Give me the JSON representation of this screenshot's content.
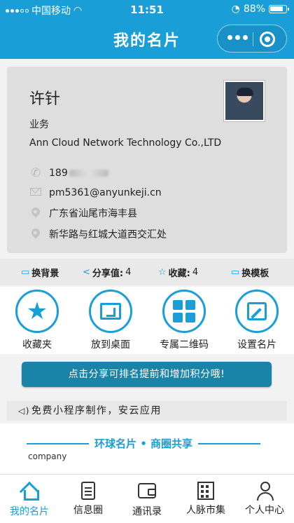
{
  "status_bar": {
    "carrier": "中国移动",
    "time": "11:51",
    "battery": "88%"
  },
  "nav": {
    "title": "我的名片"
  },
  "card": {
    "name": "许针",
    "role": "业务",
    "company": "Ann Cloud Network Technology Co.,LTD",
    "phone_visible": "189",
    "email": "pm5361@anyunkeji.cn",
    "address_line1": "广东省汕尾市海丰县",
    "address_line2": "新华路与红城大道西交汇处"
  },
  "actions": {
    "background_label": "换背景",
    "share_label": "分享值:",
    "share_value": "4",
    "favorite_label": "收藏:",
    "favorite_value": "4",
    "template_label": "换模板"
  },
  "menu": [
    {
      "label": "收藏夹",
      "icon": "star-icon"
    },
    {
      "label": "放到桌面",
      "icon": "desktop-icon"
    },
    {
      "label": "专属二维码",
      "icon": "qrcode-icon"
    },
    {
      "label": "设置名片",
      "icon": "edit-icon"
    }
  ],
  "share_button": "点击分享可排名提前和增加积分哦!",
  "notice": "免费小程序制作，安云应用",
  "slogan": "环球名片 • 商圈共享",
  "company_tag": "company",
  "tabs": [
    {
      "label": "我的名片",
      "active": true
    },
    {
      "label": "信息圈"
    },
    {
      "label": "通讯录"
    },
    {
      "label": "人脉市集"
    },
    {
      "label": "个人中心"
    }
  ],
  "colors": {
    "primary": "#1a9ed8",
    "button": "#1a84a8"
  }
}
